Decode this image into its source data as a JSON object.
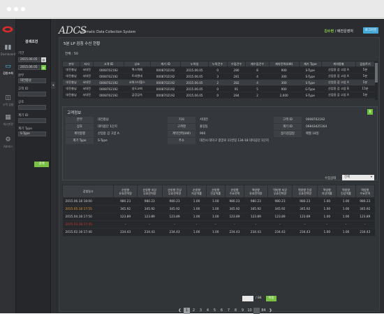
{
  "app": {
    "brand": "ADCS",
    "brand_sub": "Automatic Data Collection System",
    "user_name": "김수현",
    "user_role": "/ 배전운영처",
    "logout": "로그아웃"
  },
  "rail": {
    "items": [
      {
        "label": "Dashboard",
        "icon": "bar-chart-icon"
      },
      {
        "label": "검침조회",
        "icon": "monitor-icon"
      },
      {
        "label": "고객 검침",
        "icon": "meter-icon"
      },
      {
        "label": "게시판관",
        "icon": "calendar-icon"
      },
      {
        "label": "Admin",
        "icon": "gear-icon"
      }
    ]
  },
  "filter": {
    "title": "검색조건",
    "period_label": "기간",
    "date_from": "2015.06.05",
    "date_to": "2015.06.05",
    "hq_label": "본부",
    "hq_value": "대전충남",
    "customer_id_label": "고객 ID",
    "name_label": "상호",
    "meter_id_label": "계기 ID",
    "meter_type_label": "계기 Type",
    "meter_type_value": "S-Type",
    "search_btn": "검색"
  },
  "panel": {
    "title": "5분 LP 검침 수신 현황",
    "total": "전체 : 50"
  },
  "list": {
    "headers": [
      "본부",
      "지사",
      "고객 ID",
      "상호",
      "계기 ID",
      "누락일",
      "누락건수",
      "수집건수",
      "재수집건수",
      "계약전력(kW)",
      "계기 Type",
      "계약종별",
      "검침주기"
    ],
    "rows": [
      [
        "대전충남",
        "서대전",
        "0008702192",
        "맥스뭐예",
        "0008702192",
        "2015.06.05",
        "0",
        "280",
        "8",
        "900",
        "S-Type",
        "산업용 갑 고압 A",
        "5분"
      ],
      [
        "대전충남",
        "서대전",
        "0008702192",
        "트리엔대",
        "0008702192",
        "2015.06.05",
        "3",
        "281",
        "4",
        "300",
        "S-Type",
        "산업용 갑 고압 A",
        "5분"
      ],
      [
        "대전충남",
        "서대전",
        "0008702192",
        "서위스타헬스",
        "0008702192",
        "2015.06.05",
        "2",
        "282",
        "4",
        "300",
        "S-Type",
        "산업용 갑 고압 A",
        "5분"
      ],
      [
        "대전충남",
        "서대전",
        "0008702192",
        "성도교회",
        "0008702192",
        "2015.06.05",
        "0",
        "91",
        "5",
        "900",
        "G-Type",
        "산업용 갑 고압 B",
        "15분"
      ],
      [
        "대전충남",
        "서대전",
        "0008702192",
        "금강급속",
        "0008702192",
        "2015.06.05",
        "0",
        "284",
        "2",
        "2,000",
        "S-Type",
        "산업용 갑 고압 A",
        "5분"
      ]
    ]
  },
  "detail": {
    "title": "고객정보",
    "fields": [
      {
        "label": "본부",
        "value": "대전충남"
      },
      {
        "label": "지사",
        "value": "서대전"
      },
      {
        "label": "고객 ID",
        "value": "0008702192"
      },
      {
        "label": "상호",
        "value": "대이콤단 1단지"
      },
      {
        "label": "고객명",
        "value": "홍길동"
      },
      {
        "label": "계기 ID",
        "value": "06843425164"
      },
      {
        "label": "계약종별",
        "value": "산업용 갑 고압 A"
      },
      {
        "label": "계약전력(kW)",
        "value": "900"
      },
      {
        "label": "정기검침일",
        "value": "매월 18일"
      },
      {
        "label": "계기 Type",
        "value": "S-Type"
      },
      {
        "label": "주소",
        "value": "대전시 대덕구 중앙로 11번길 134-18 대덕공단 1단지"
      }
    ]
  },
  "data_filter": {
    "label": "수집상태",
    "value": "전체"
  },
  "data": {
    "headers": [
      "검침일시",
      "순방향\n유효전력량",
      "순방향 지상\n무효전력량",
      "순방향 진상\n무효전력량",
      "순방향\n지상역률",
      "순방향\n진상역률",
      "순방향\n수요전력",
      "역방향\n유효전력량",
      "역방향 지상\n무효전력량",
      "역방향 진상\n무효전력량",
      "역방향\n지상역률",
      "역방향\n진상역률",
      "역방향\n수요전력"
    ],
    "rows": [
      {
        "ts": "2015.06.18 18:00",
        "color": "#d0d0d0",
        "vals": [
          "980.23",
          "980.23",
          "980.23",
          "1.00",
          "1.00",
          "980.23",
          "980.23",
          "980.23",
          "980.23",
          "1.00",
          "1.00",
          "980.23"
        ]
      },
      {
        "ts": "2015.05.18 17:55",
        "color": "#e69a3c",
        "vals": [
          "345.92",
          "345.92",
          "345.92",
          "1.00",
          "1.00",
          "345.92",
          "345.92",
          "345.92",
          "345.92",
          "1.00",
          "1.00",
          "345.92"
        ]
      },
      {
        "ts": "2015.04.18 17:50",
        "color": "#d0d0d0",
        "vals": [
          "123.89",
          "123.89",
          "123.89",
          "1.00",
          "1.00",
          "123.89",
          "123.89",
          "123.89",
          "123.89",
          "1.00",
          "1.00",
          "123.89"
        ]
      },
      {
        "ts": "2015.03.18 17:45",
        "color": "#c8382e",
        "vals": [
          "-",
          "-",
          "-",
          "-",
          "-",
          "-",
          "-",
          "-",
          "-",
          "-",
          "-",
          "-"
        ]
      },
      {
        "ts": "2015.02.18 17:40",
        "color": "#d0d0d0",
        "vals": [
          "234.43",
          "234.43",
          "234.43",
          "1.00",
          "1.00",
          "234.43",
          "234.43",
          "234.43",
          "234.43",
          "1.00",
          "1.00",
          "234.43"
        ]
      }
    ]
  },
  "pager": {
    "total": "/ 84",
    "move": "이동",
    "pages": [
      "1",
      "2",
      "3",
      "4",
      "5",
      "6",
      "7",
      "8",
      "9",
      "10"
    ],
    "last": "84",
    "current": "1"
  }
}
